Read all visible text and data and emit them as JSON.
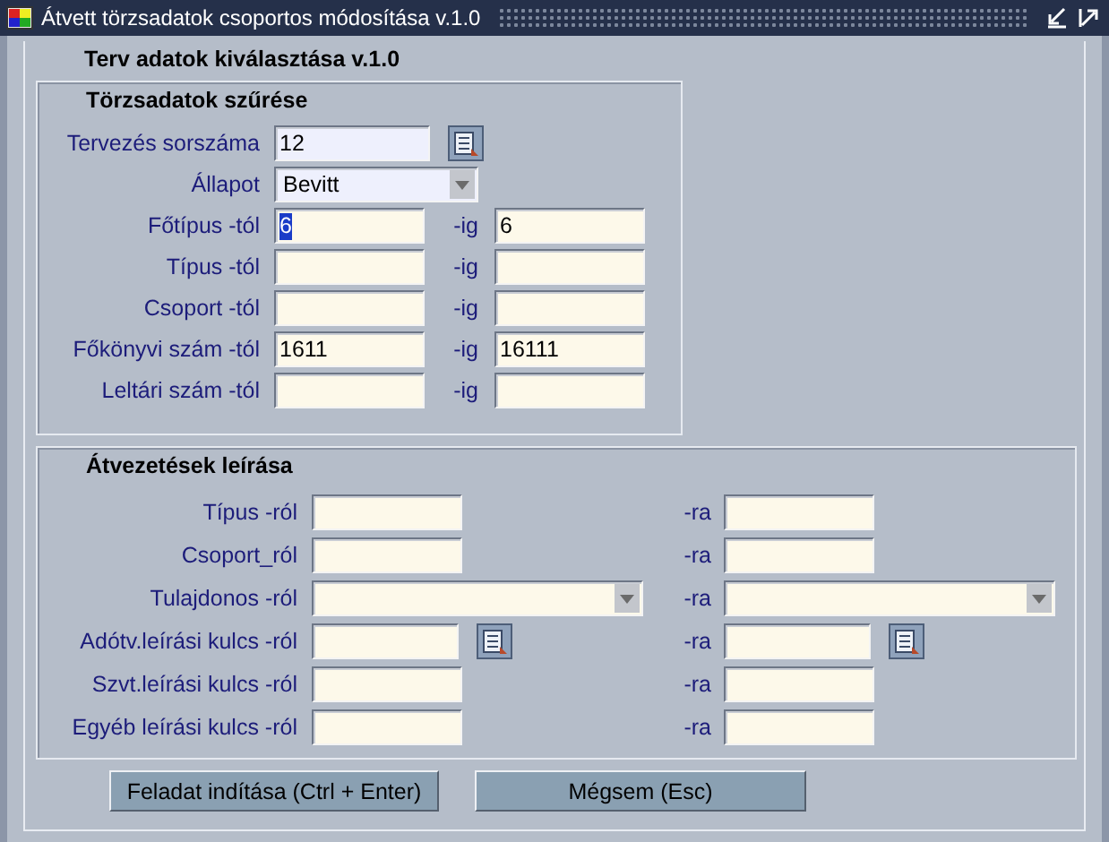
{
  "window": {
    "title": "Átvett törzsadatok csoportos módosítása v.1.0"
  },
  "form_title": "Terv adatok kiválasztása v.1.0",
  "filter": {
    "title": "Törzsadatok szűrése",
    "rows": [
      {
        "kind": "text",
        "label": "Tervezés sorszáma",
        "value": "12",
        "lookup": true
      },
      {
        "kind": "dropdown",
        "label": "Állapot",
        "value": "Bevitt",
        "lookup": false
      },
      {
        "kind": "range",
        "label": "Főtípus -tól",
        "from": "6",
        "from_text_selected": true,
        "to_label": "-ig",
        "to": "6"
      },
      {
        "kind": "range",
        "label": "Típus -tól",
        "from_text_selected": false,
        "to_label": "-ig"
      },
      {
        "kind": "range",
        "label": "Csoport -tól",
        "from_text_selected": false,
        "to_label": "-ig"
      },
      {
        "kind": "range",
        "label": "Főkönyvi szám -tól",
        "from": "1611",
        "from_text_selected": false,
        "to_label": "-ig",
        "to": "16111"
      },
      {
        "kind": "range",
        "label": "Leltári szám -tól",
        "from_text_selected": false,
        "to_label": "-ig"
      }
    ]
  },
  "transfers": {
    "title": "Átvezetések leírása",
    "rows": [
      {
        "kind": "text",
        "label": "Típus -ról",
        "lookup": false,
        "to_label": "-ra"
      },
      {
        "kind": "text",
        "label": "Csoport_ról",
        "lookup": false,
        "to_label": "-ra"
      },
      {
        "kind": "dropdown",
        "label": "Tulajdonos -ról",
        "lookup": false,
        "to_label": "-ra"
      },
      {
        "kind": "text",
        "label": "Adótv.leírási kulcs -ról",
        "lookup": true,
        "to_label": "-ra"
      },
      {
        "kind": "text",
        "label": "Szvt.leírási kulcs -ról",
        "lookup": false,
        "to_label": "-ra"
      },
      {
        "kind": "text",
        "label": "Egyéb leírási kulcs -ról",
        "lookup": false,
        "to_label": "-ra"
      }
    ]
  },
  "buttons": [
    "Feladat indítása (Ctrl + Enter)",
    "Mégsem (Esc)"
  ]
}
